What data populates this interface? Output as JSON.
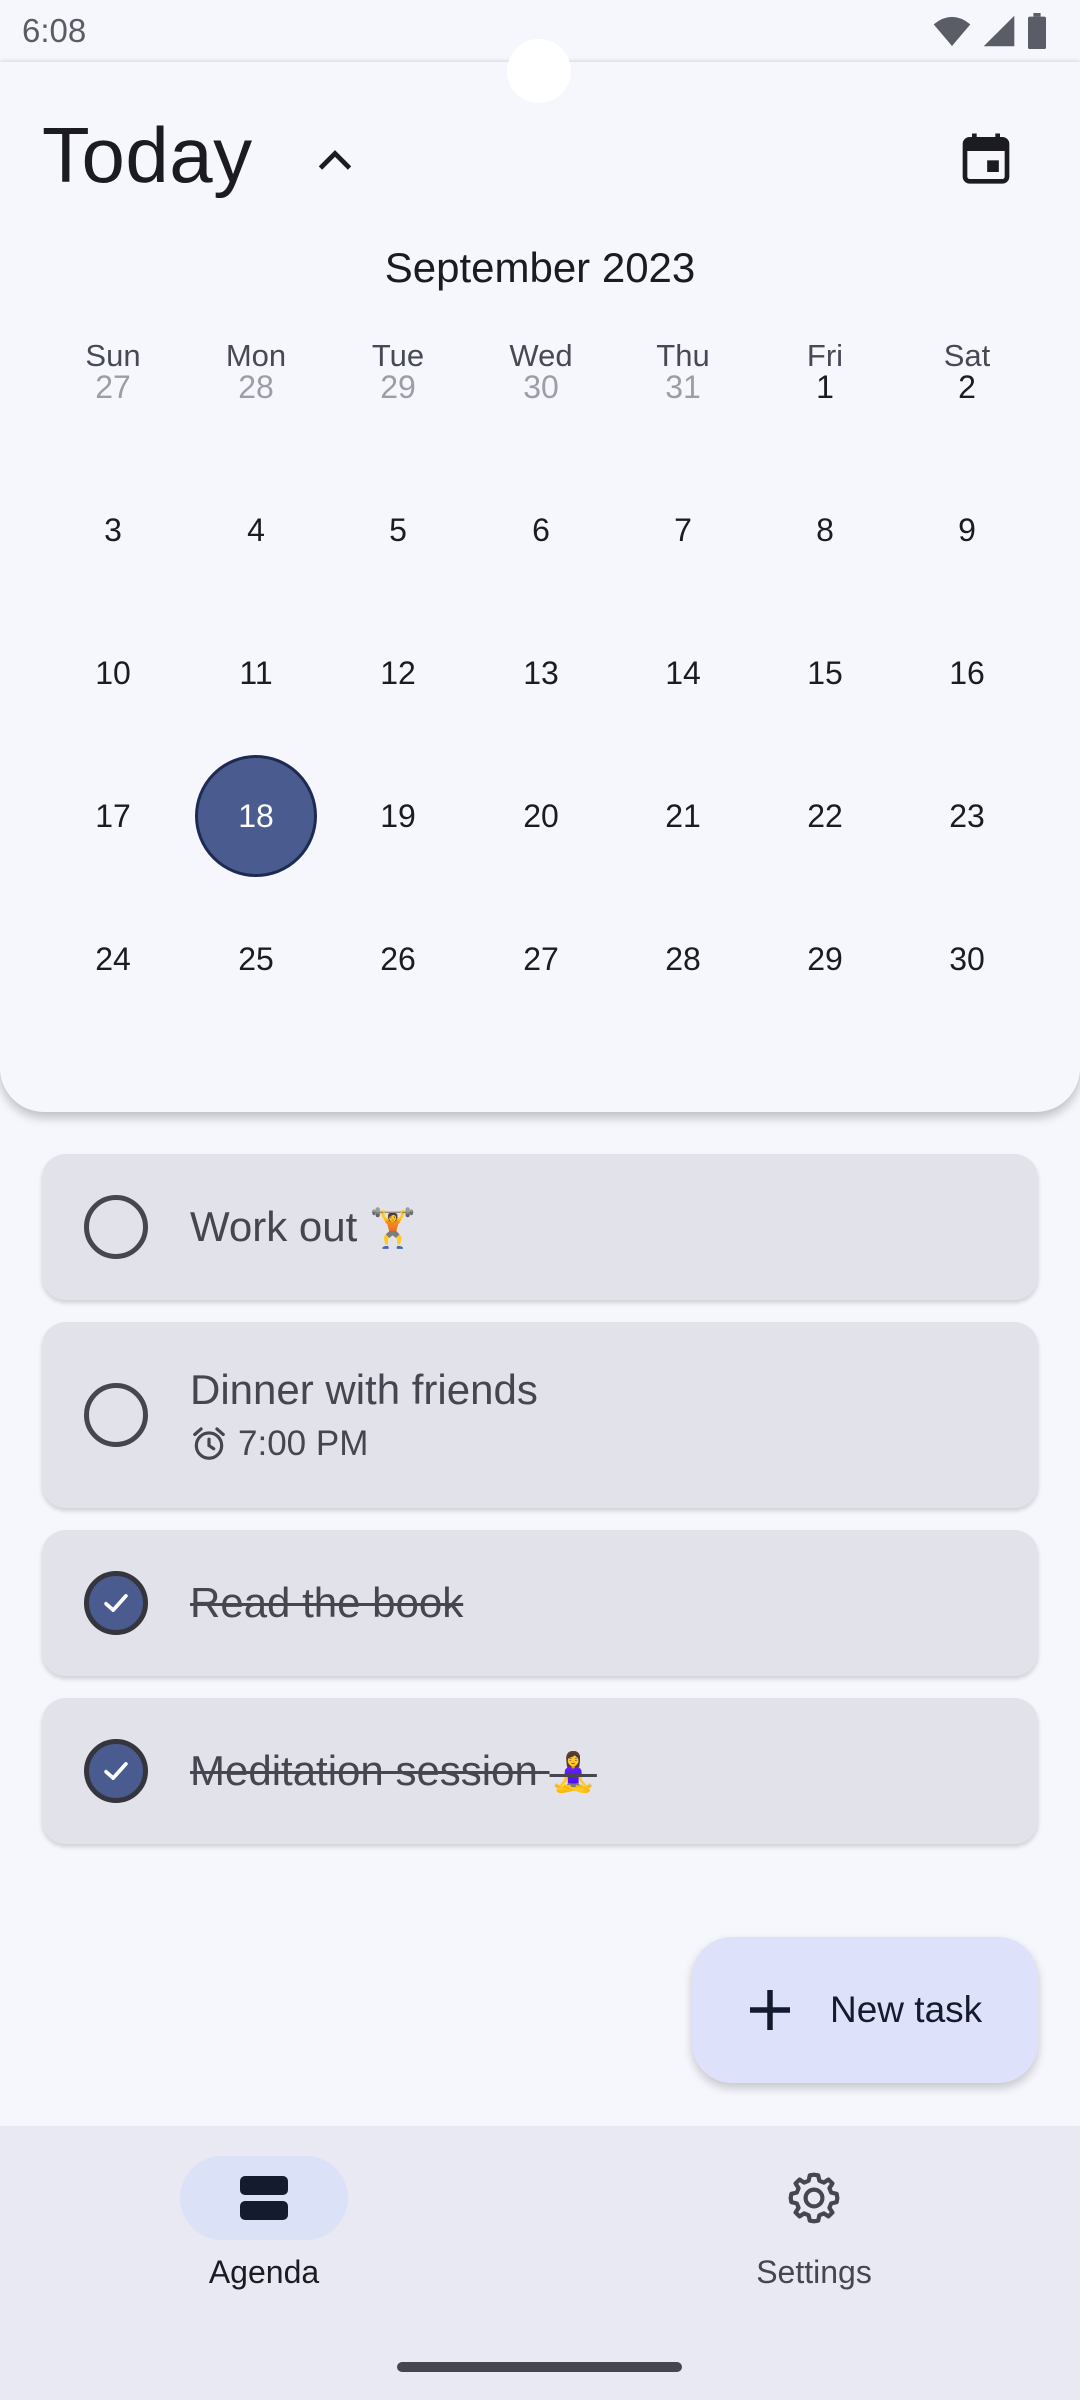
{
  "status_bar": {
    "time": "6:08"
  },
  "header": {
    "title": "Today"
  },
  "calendar": {
    "month_title": "September 2023",
    "weekdays": [
      "Sun",
      "Mon",
      "Tue",
      "Wed",
      "Thu",
      "Fri",
      "Sat"
    ],
    "weeks": [
      [
        "27",
        "28",
        "29",
        "30",
        "31",
        "1",
        "2"
      ],
      [
        "3",
        "4",
        "5",
        "6",
        "7",
        "8",
        "9"
      ],
      [
        "10",
        "11",
        "12",
        "13",
        "14",
        "15",
        "16"
      ],
      [
        "17",
        "18",
        "19",
        "20",
        "21",
        "22",
        "23"
      ],
      [
        "24",
        "25",
        "26",
        "27",
        "28",
        "29",
        "30"
      ]
    ],
    "selected_day": "18"
  },
  "tasks": [
    {
      "title": "Work out",
      "emoji": "🏋️",
      "time": "",
      "done": false
    },
    {
      "title": "Dinner with friends",
      "emoji": "",
      "time": "7:00 PM",
      "done": false
    },
    {
      "title": "Read the book",
      "emoji": "",
      "time": "",
      "done": true
    },
    {
      "title": "Meditation session",
      "emoji": "🧘‍♀️",
      "time": "",
      "done": true
    }
  ],
  "fab": {
    "label": "New task"
  },
  "nav": {
    "items": [
      {
        "label": "Agenda",
        "icon": "agenda-icon",
        "active": true
      },
      {
        "label": "Settings",
        "icon": "gear-icon",
        "active": false
      }
    ]
  },
  "colors": {
    "accent": "#4a5b8f",
    "card": "#e2e2ea",
    "fab": "#dde2fa",
    "nav_bg": "#e8e9f3"
  }
}
